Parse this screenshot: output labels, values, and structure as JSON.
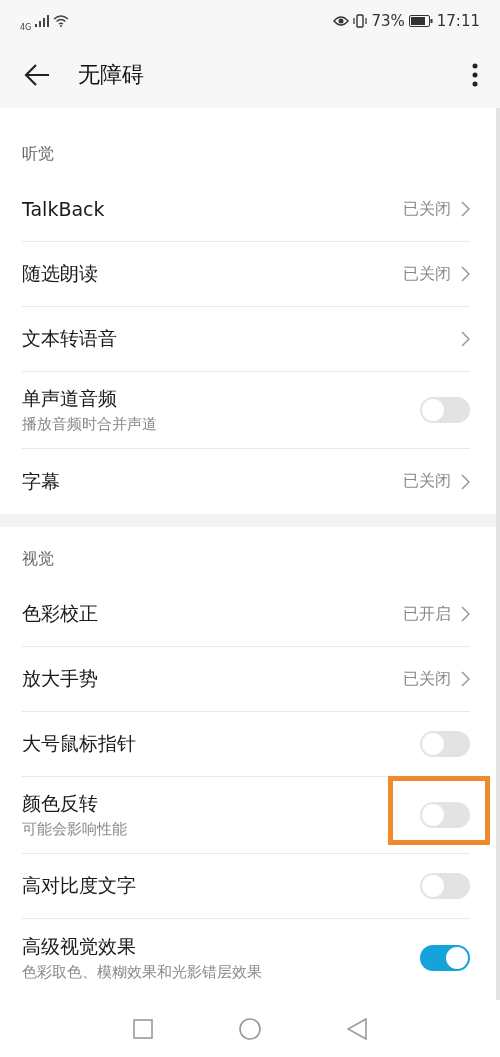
{
  "status_bar": {
    "network": "4G",
    "battery": "73%",
    "time": "17:11"
  },
  "app_bar": {
    "title": "无障碍"
  },
  "sections": [
    {
      "title": "听觉",
      "items": [
        {
          "kind": "link",
          "label": "TalkBack",
          "value": "已关闭"
        },
        {
          "kind": "link",
          "label": "随选朗读",
          "value": "已关闭"
        },
        {
          "kind": "link",
          "label": "文本转语音"
        },
        {
          "kind": "switch",
          "label": "单声道音频",
          "subtitle": "播放音频时合并声道",
          "on": false
        },
        {
          "kind": "link",
          "label": "字幕",
          "value": "已关闭"
        }
      ]
    },
    {
      "title": "视觉",
      "items": [
        {
          "kind": "link",
          "label": "色彩校正",
          "value": "已开启"
        },
        {
          "kind": "link",
          "label": "放大手势",
          "value": "已关闭"
        },
        {
          "kind": "switch",
          "label": "大号鼠标指针",
          "on": false
        },
        {
          "kind": "switch",
          "label": "颜色反转",
          "subtitle": "可能会影响性能",
          "on": false,
          "highlighted": true
        },
        {
          "kind": "switch",
          "label": "高对比度文字",
          "on": false
        },
        {
          "kind": "switch",
          "label": "高级视觉效果",
          "subtitle": "色彩取色、模糊效果和光影错层效果",
          "on": true
        }
      ]
    }
  ]
}
